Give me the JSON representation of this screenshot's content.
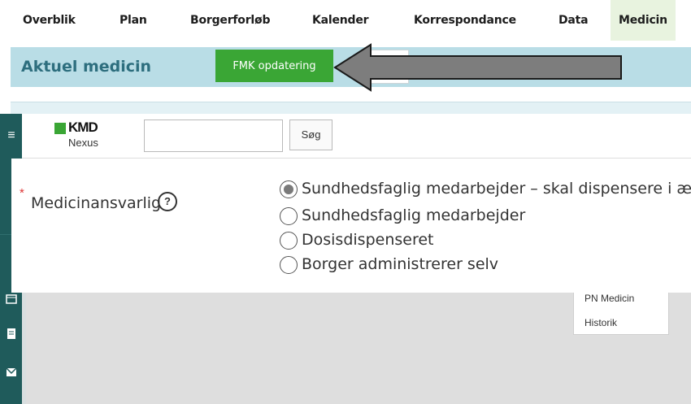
{
  "nav": {
    "items": [
      "Overblik",
      "Plan",
      "Borgerforløb",
      "Kalender",
      "Korrespondance",
      "Data",
      "Medicin"
    ],
    "active": "Medicin"
  },
  "header": {
    "title": "Aktuel medicin",
    "fmk_button": "FMK opdatering"
  },
  "nexus": {
    "logo_brand": "KMD",
    "logo_sub": "Nexus",
    "search_value": "",
    "search_button": "Søg"
  },
  "form": {
    "required_mark": "*",
    "field_label": "Medicinansvarlig",
    "help_symbol": "?",
    "options": [
      "Sundhedsfaglig medarbejder – skal dispensere i æske",
      "Sundhedsfaglig medarbejder",
      "Dosisdispenseret",
      "Borger administrerer selv"
    ],
    "selected_index": 0
  },
  "dropdown": {
    "items": [
      "PN Medicin",
      "Historik"
    ]
  },
  "colors": {
    "accent_green": "#3aa635",
    "header_bg": "#b9dde6",
    "rail": "#1f5b5b",
    "title_teal": "#2d6e7e"
  }
}
